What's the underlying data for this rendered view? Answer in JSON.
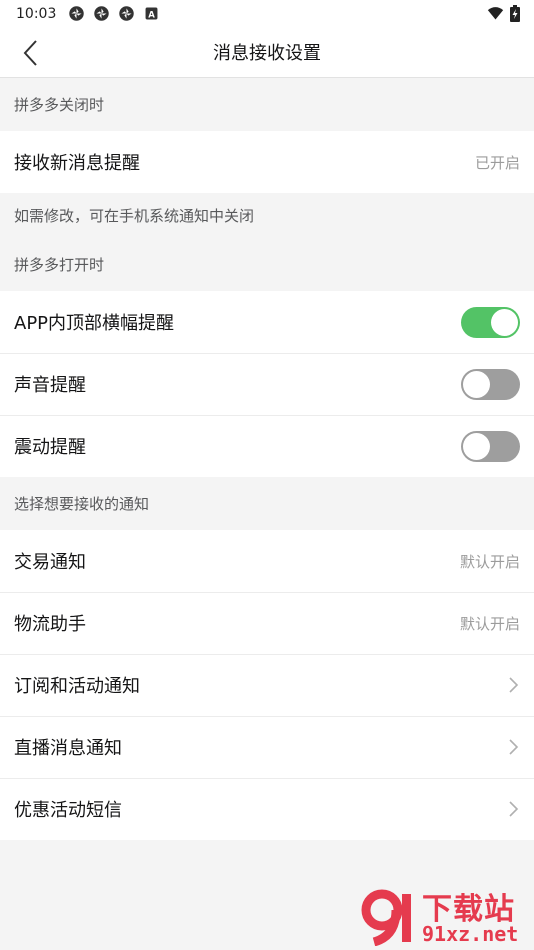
{
  "status_bar": {
    "time": "10:03",
    "left_icons": [
      "app-notification-icon",
      "app-notification-icon",
      "app-notification-icon",
      "a-badge-icon"
    ],
    "a_badge_text": "A",
    "right_icons": [
      "wifi-icon",
      "battery-charging-icon"
    ]
  },
  "nav": {
    "title": "消息接收设置",
    "back_icon": "chevron-left-icon"
  },
  "section_closed": {
    "header": "拼多多关闭时",
    "row_label": "接收新消息提醒",
    "row_value": "已开启",
    "note": "如需修改，可在手机系统通知中关闭"
  },
  "section_open": {
    "header": "拼多多打开时",
    "rows": [
      {
        "label": "APP内顶部横幅提醒",
        "on": true
      },
      {
        "label": "声音提醒",
        "on": false
      },
      {
        "label": "震动提醒",
        "on": false
      }
    ]
  },
  "section_notify": {
    "header": "选择想要接收的通知",
    "rows": [
      {
        "label": "交易通知",
        "value": "默认开启"
      },
      {
        "label": "物流助手",
        "value": "默认开启"
      },
      {
        "label": "订阅和活动通知",
        "icon": "chevron-right-icon"
      },
      {
        "label": "直播消息通知",
        "icon": "chevron-right-icon"
      },
      {
        "label": "优惠活动短信",
        "icon": "chevron-right-icon"
      }
    ]
  },
  "watermark": {
    "text": "下载站",
    "url": "91xz.net"
  },
  "colors": {
    "toggle_on": "#53c366",
    "toggle_off": "#9e9e9e",
    "watermark": "#e53b4e",
    "background": "#f4f4f4"
  }
}
